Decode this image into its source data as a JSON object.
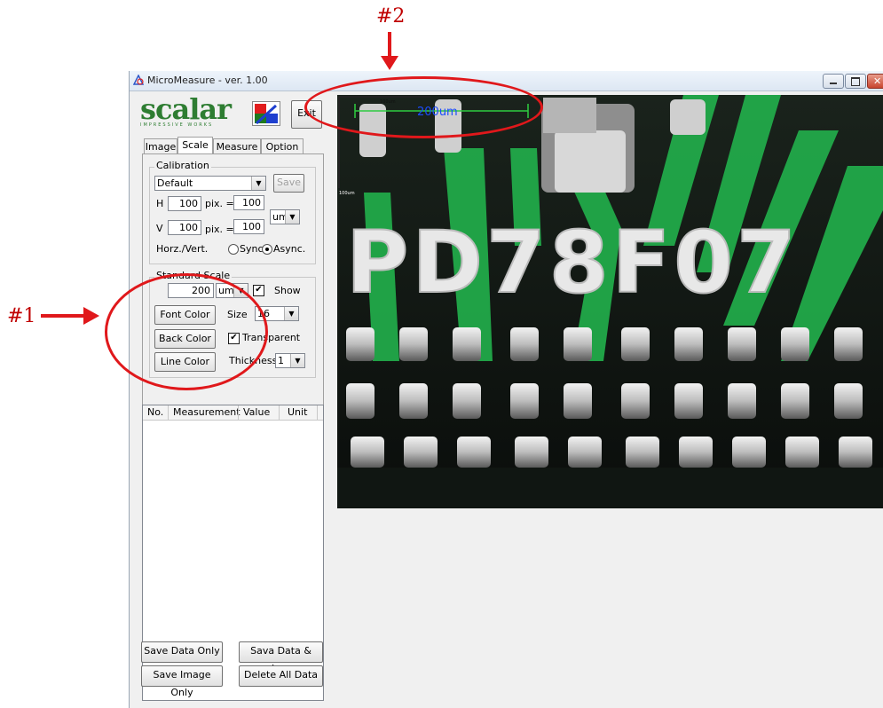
{
  "annotations": {
    "label_1": "#1",
    "label_2": "#2"
  },
  "window": {
    "title": "MicroMeasure - ver. 1.00"
  },
  "logo": {
    "brand": "SCALAR",
    "tagline": "IMPRESSIVE WORKS"
  },
  "header": {
    "exit_label": "Exit"
  },
  "tabs": [
    "Image",
    "Scale",
    "Measure",
    "Option"
  ],
  "calibration": {
    "title": "Calibration",
    "preset": "Default",
    "save_label": "Save",
    "h_label": "H",
    "h_pix": "100",
    "pix_eq": "pix. =",
    "h_value": "100",
    "v_label": "V",
    "v_pix": "100",
    "v_value": "100",
    "unit": "um",
    "horz_vert_label": "Horz./Vert.",
    "sync_label": "Sync",
    "async_label": "Async.",
    "mode": "Async."
  },
  "standard_scale": {
    "title": "Standard Scale",
    "value": "200",
    "unit": "um",
    "show_label": "Show",
    "show_checked": true,
    "font_color_label": "Font Color",
    "size_label": "Size",
    "size_value": "16",
    "back_color_label": "Back Color",
    "transparent_label": "Transparent",
    "transparent_checked": true,
    "line_color_label": "Line Color",
    "thickness_label": "Thickness",
    "thickness_value": "1"
  },
  "table": {
    "columns": [
      "No.",
      "Measurement",
      "Value",
      "Unit"
    ]
  },
  "footer": {
    "save_data_only": "Save Data Only",
    "save_data_img": "Sava Data & Img",
    "save_image_only": "Save Image Only",
    "delete_all": "Delete All Data"
  },
  "image_overlay": {
    "scale_text": "200um",
    "corner_text": "100um",
    "pcb_text": "PD78F07",
    "colors": {
      "scale_line": "#2ecc40",
      "scale_text": "#1a4cff",
      "board": "#0c110e",
      "trace": "#22b14c"
    }
  }
}
